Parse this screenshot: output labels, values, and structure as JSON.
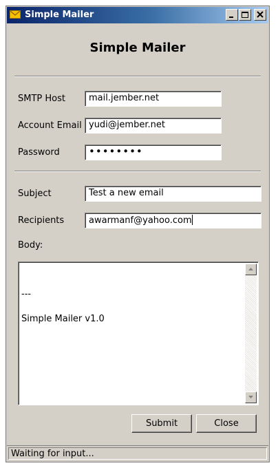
{
  "window": {
    "title": "Simple Mailer",
    "icon": "envelope-icon",
    "controls": {
      "minimize_icon": "minimize-icon",
      "maximize_icon": "maximize-icon",
      "close_icon": "close-icon"
    }
  },
  "header": {
    "title": "Simple Mailer"
  },
  "smtp": {
    "host_label": "SMTP Host",
    "host_value": "mail.jember.net",
    "email_label": "Account Email",
    "email_value": "yudi@jember.net",
    "password_label": "Password",
    "password_value": "••••••••"
  },
  "message": {
    "subject_label": "Subject",
    "subject_value": "Test a new email",
    "recipients_label": "Recipients",
    "recipients_value": "awarmanf@yahoo.com",
    "body_label": "Body:",
    "body_lines": [
      "",
      "---",
      "",
      "Simple Mailer v1.0"
    ]
  },
  "buttons": {
    "submit": "Submit",
    "close": "Close"
  },
  "status": {
    "text": "Waiting for input..."
  },
  "colors": {
    "window_bg": "#d4d0c8",
    "titlebar_start": "#0a246a",
    "titlebar_end": "#a6caf0",
    "titlebar_text": "#ffffff"
  }
}
